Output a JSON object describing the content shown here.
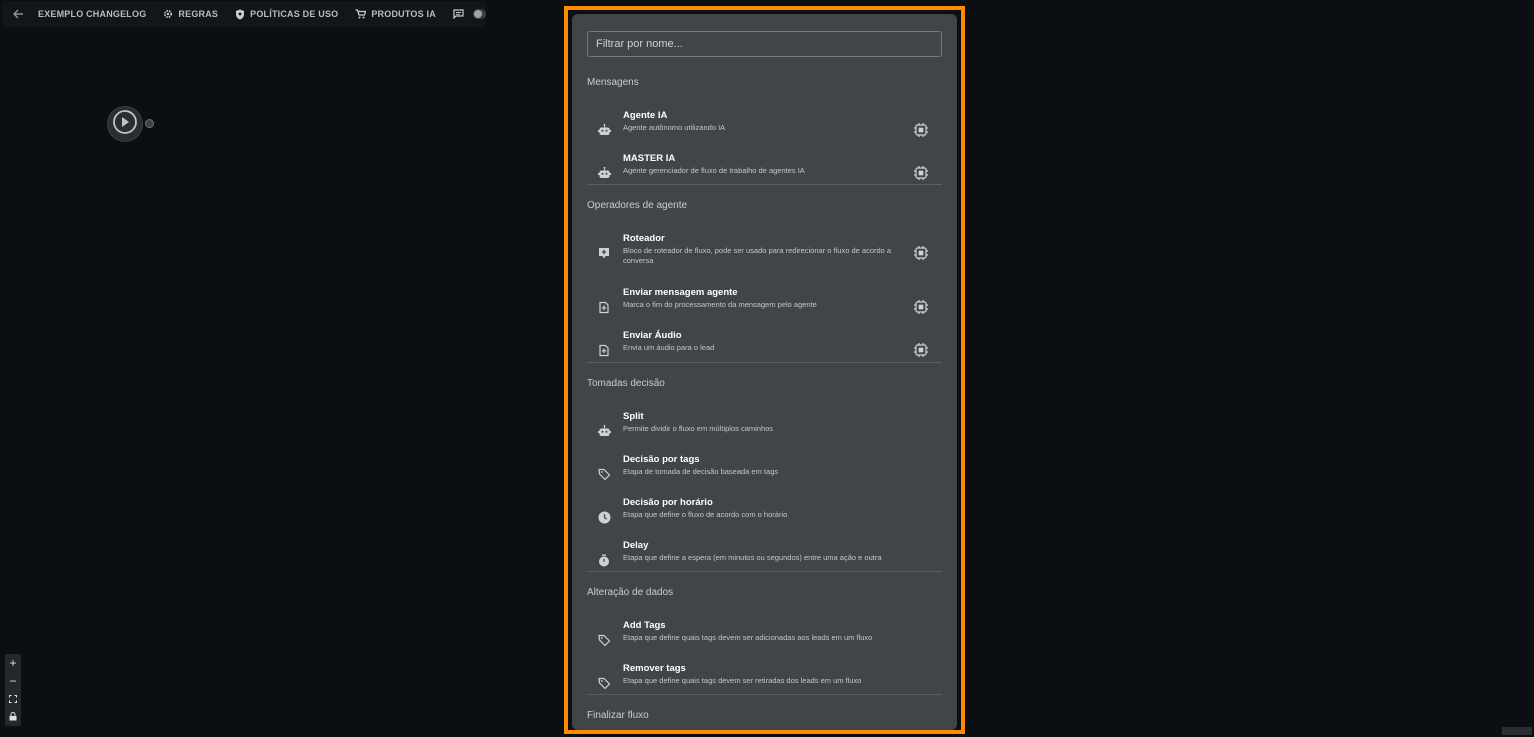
{
  "topbar": {
    "items": [
      {
        "label": "EXEMPLO CHANGELOG"
      },
      {
        "label": "REGRAS",
        "icon": "gear-icon"
      },
      {
        "label": "POLÍTICAS DE USO",
        "icon": "shield-icon"
      },
      {
        "label": "PRODUTOS IA",
        "icon": "cart-icon"
      }
    ]
  },
  "panel": {
    "filter_placeholder": "Filtrar por nome...",
    "sections": [
      {
        "title": "Mensagens",
        "items": [
          {
            "name": "Agente IA",
            "desc": "Agente autônomo utilizando IA",
            "icon": "robot-icon"
          },
          {
            "name": "MASTER IA",
            "desc": "Agente gerenciador de fluxo de trabalho de agentes IA",
            "icon": "robot-icon"
          }
        ]
      },
      {
        "title": "Operadores de agente",
        "items": [
          {
            "name": "Roteador",
            "desc": "Bloco de roteador de fluxo, pode ser usado para redirecionar o fluxo de acordo a conversa",
            "icon": "router-icon"
          },
          {
            "name": "Enviar mensagem agente",
            "desc": "Marca o fim do processamento da mensagem pelo agente",
            "icon": "send-icon"
          },
          {
            "name": "Enviar Áudio",
            "desc": "Envia um áudio para o lead",
            "icon": "send-icon"
          }
        ]
      },
      {
        "title": "Tomadas decisão",
        "items": [
          {
            "name": "Split",
            "desc": "Permite dividir o fluxo em múltiplos caminhos",
            "icon": "robot-icon"
          },
          {
            "name": "Decisão por tags",
            "desc": "Etapa de tomada de decisão baseada em tags",
            "icon": "tag-icon"
          },
          {
            "name": "Decisão por horário",
            "desc": "Etapa que define o fluxo de acordo com o horário",
            "icon": "clock-icon"
          },
          {
            "name": "Delay",
            "desc": "Etapa que define a espera (em minutos ou segundos) entre uma ação e outra",
            "icon": "timer-icon"
          }
        ]
      },
      {
        "title": "Alteração de dados",
        "items": [
          {
            "name": "Add Tags",
            "desc": "Etapa que define quais tags devem ser adicionadas aos leads em um fluxo",
            "icon": "tag-icon"
          },
          {
            "name": "Remover tags",
            "desc": "Etapa que define quais tags devem ser retiradas dos leads em um fluxo",
            "icon": "tag-icon"
          }
        ]
      },
      {
        "title": "Finalizar fluxo",
        "items": []
      }
    ]
  },
  "zoom_controls": [
    "+",
    "−"
  ]
}
